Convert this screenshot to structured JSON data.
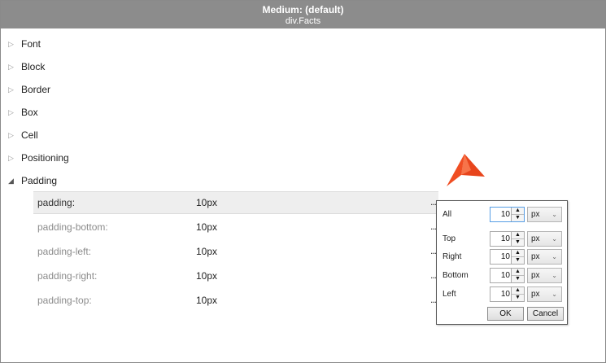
{
  "window": {
    "title": "Medium: (default)",
    "subtitle": "div.Facts"
  },
  "categories": [
    {
      "label": "Font",
      "expanded": false
    },
    {
      "label": "Block",
      "expanded": false
    },
    {
      "label": "Border",
      "expanded": false
    },
    {
      "label": "Box",
      "expanded": false
    },
    {
      "label": "Cell",
      "expanded": false
    },
    {
      "label": "Positioning",
      "expanded": false
    },
    {
      "label": "Padding",
      "expanded": true
    }
  ],
  "properties": [
    {
      "name": "padding:",
      "value": "10px",
      "more": "..."
    },
    {
      "name": "padding-bottom:",
      "value": "10px",
      "more": "..."
    },
    {
      "name": "padding-left:",
      "value": "10px",
      "more": "..."
    },
    {
      "name": "padding-right:",
      "value": "10px",
      "more": "..."
    },
    {
      "name": "padding-top:",
      "value": "10px",
      "more": "..."
    }
  ],
  "popup": {
    "rows": [
      {
        "label": "All",
        "value": "10",
        "unit": "px"
      },
      {
        "label": "Top",
        "value": "10",
        "unit": "px"
      },
      {
        "label": "Right",
        "value": "10",
        "unit": "px"
      },
      {
        "label": "Bottom",
        "value": "10",
        "unit": "px"
      },
      {
        "label": "Left",
        "value": "10",
        "unit": "px"
      }
    ],
    "ok_label": "OK",
    "cancel_label": "Cancel"
  },
  "icons": {
    "collapsed": "triangle-right-icon",
    "expanded": "triangle-down-icon",
    "spin_up": "spin-up-icon",
    "spin_down": "spin-down-icon",
    "dropdown": "chevron-down-icon",
    "pointer": "mouse-pointer-icon"
  },
  "colors": {
    "titlebar": "#8c8c8c",
    "pointer": "#f04e23",
    "focus_border": "#569de5"
  }
}
